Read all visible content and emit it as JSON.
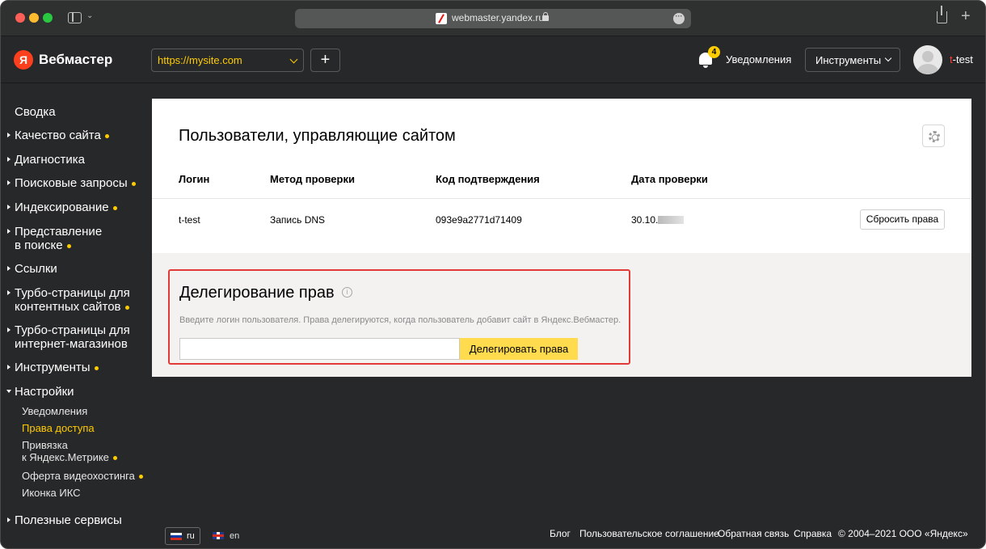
{
  "browser": {
    "url": "webmaster.yandex.ru"
  },
  "header": {
    "logo_letter": "Я",
    "brand": "Вебмастер",
    "site_select": "https://mysite.com",
    "add_button": "+",
    "notifications_count": "4",
    "notifications_label": "Уведомления",
    "tools_label": "Инструменты",
    "user_login_first": "t",
    "user_login_rest": "-test"
  },
  "sidebar": {
    "items": [
      {
        "label": "Сводка"
      },
      {
        "label": "Качество сайта"
      },
      {
        "label": "Диагностика"
      },
      {
        "label": "Поисковые запросы"
      },
      {
        "label": "Индексирование"
      },
      {
        "label_line1": "Представление",
        "label_line2": "в поиске"
      },
      {
        "label": "Ссылки"
      },
      {
        "label_line1": "Турбо-страницы для",
        "label_line2": "контентных сайтов"
      },
      {
        "label_line1": "Турбо-страницы для",
        "label_line2": "интернет-магазинов"
      },
      {
        "label": "Инструменты"
      },
      {
        "label": "Настройки"
      },
      {
        "label": "Полезные сервисы"
      }
    ],
    "settings_sub": [
      {
        "label": "Уведомления"
      },
      {
        "label": "Права доступа"
      },
      {
        "label_line1": "Привязка",
        "label_line2": "к Яндекс.Метрике"
      },
      {
        "label": "Оферта видеохостинга"
      },
      {
        "label": "Иконка ИКС"
      }
    ]
  },
  "main": {
    "title": "Пользователи, управляющие сайтом",
    "columns": [
      "Логин",
      "Метод проверки",
      "Код подтверждения",
      "Дата проверки"
    ],
    "rows": [
      {
        "login": "t-test",
        "method": "Запись DNS",
        "code": "093e9a2771d71409",
        "date": "30.10."
      }
    ],
    "reset_button": "Сбросить права",
    "delegation": {
      "title": "Делегирование прав",
      "info_icon": "i",
      "hint": "Введите логин пользователя. Права делегируются, когда пользователь добавит сайт в Яндекс.Вебмастер.",
      "input_value": "",
      "submit_label": "Делегировать права"
    }
  },
  "footer": {
    "lang_ru": "ru",
    "lang_en": "en",
    "links": [
      "Блог",
      "Пользовательское соглашение",
      "Обратная связь",
      "Справка"
    ],
    "copyright": "© 2004–2021 ООО «Яндекс»"
  },
  "colors": {
    "accent_yellow": "#ffcc00",
    "button_yellow": "#ffdb4d",
    "highlight_red": "#e23a36",
    "yandex_red": "#fc3f1d"
  }
}
